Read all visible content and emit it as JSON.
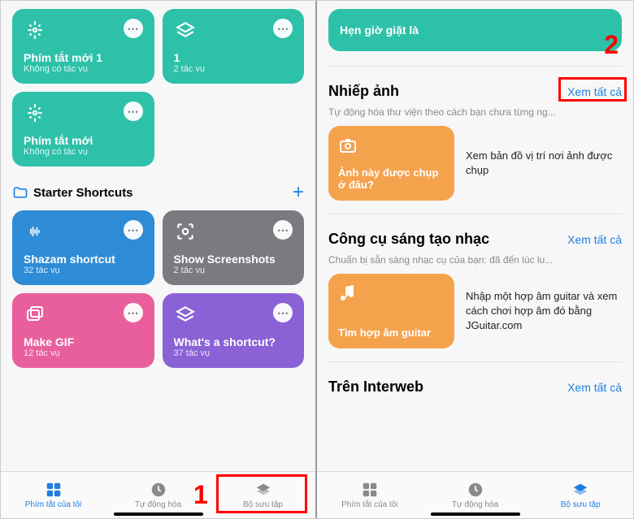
{
  "left": {
    "tiles_a": [
      {
        "name": "Phím tắt mới 1",
        "sub": "Không có tác vụ"
      },
      {
        "name": "1",
        "sub": "2 tác vụ"
      }
    ],
    "tile_b": {
      "name": "Phím tắt mới",
      "sub": "Không có tác vụ"
    },
    "section_title": "Starter Shortcuts",
    "tiles_c": [
      {
        "name": "Shazam shortcut",
        "sub": "32 tác vụ"
      },
      {
        "name": "Show Screenshots",
        "sub": "2 tác vụ"
      }
    ],
    "tiles_d": [
      {
        "name": "Make GIF",
        "sub": "12 tác vụ"
      },
      {
        "name": "What's a shortcut?",
        "sub": "37 tác vụ"
      }
    ],
    "tabs": [
      "Phím tắt của tôi",
      "Tự động hóa",
      "Bộ sưu tập"
    ]
  },
  "right": {
    "top_tile": "Hẹn giờ giặt là",
    "sec1": {
      "title": "Nhiếp ảnh",
      "see_all": "Xem tất cả",
      "sub": "Tự động hóa thư viện theo cách bạn chưa từng ng...",
      "tile_name": "Ảnh này được chụp ở đâu?",
      "desc": "Xem bản đồ vị trí nơi ảnh được chụp"
    },
    "sec2": {
      "title": "Công cụ sáng tạo nhạc",
      "see_all": "Xem tất cả",
      "sub": "Chuẩn bị sẵn sàng nhạc cụ của bạn: đã đến lúc lu...",
      "tile_name": "Tìm hợp âm guitar",
      "desc": "Nhập một hợp âm guitar và xem cách chơi hợp âm đó bằng JGuitar.com"
    },
    "sec3": {
      "title": "Trên Interweb",
      "see_all": "Xem tất cả"
    },
    "tabs": [
      "Phím tắt của tôi",
      "Tự động hóa",
      "Bộ sưu tập"
    ]
  },
  "anno": {
    "one": "1",
    "two": "2"
  }
}
